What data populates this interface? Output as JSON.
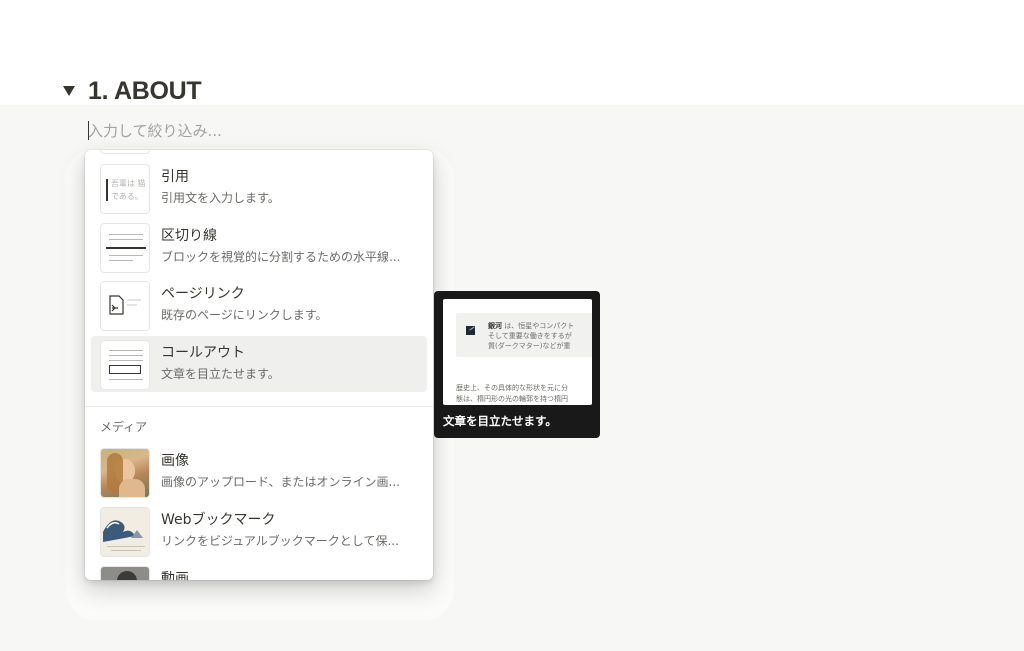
{
  "heading": {
    "text": "1. ABOUT"
  },
  "filter": {
    "placeholder": "入力して絞り込み..."
  },
  "menu": {
    "items_top": [
      {
        "title": "引用",
        "description": "引用文を入力します。",
        "thumb_text": "吾輩は 猫である。"
      },
      {
        "title": "区切り線",
        "description": "ブロックを視覚的に分割するための水平線..."
      },
      {
        "title": "ページリンク",
        "description": "既存のページにリンクします。"
      },
      {
        "title": "コールアウト",
        "description": "文章を目立たせます。"
      }
    ],
    "section_media": "メディア",
    "items_media": [
      {
        "title": "画像",
        "description": "画像のアップロード、またはオンライン画..."
      },
      {
        "title": "Webブックマーク",
        "description": "リンクをビジュアルブックマークとして保..."
      },
      {
        "title": "動画",
        "description": ""
      }
    ]
  },
  "preview": {
    "callout_lines": [
      {
        "bold": "銀河",
        "rest": " は、恒星やコンパクト"
      },
      {
        "bold": "",
        "rest": "そして重要な働きをするが"
      },
      {
        "bold": "",
        "rest": "質(ダークマター)などが重"
      }
    ],
    "para_lines": [
      "歴史上、その具体的な形状を元に分",
      "態は、楕円形の光の輪郭を持つ楕円"
    ],
    "caption": "文章を目立たせます。"
  }
}
